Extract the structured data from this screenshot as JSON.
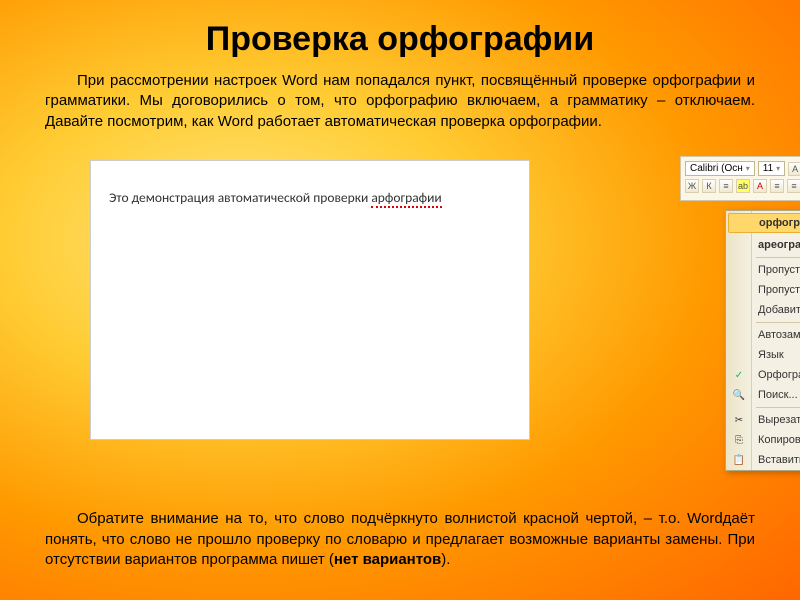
{
  "title": "Проверка орфографии",
  "para1": "При рассмотрении настроек Word нам попадался пункт, посвящённый проверке орфографии и грамматики. Мы договорились о том, что орфографию включаем, а грамматику – отключаем. Давайте посмотрим, как Word работает автоматическая проверка орфографии.",
  "para2_a": "Обратите внимание на то, что слово подчёркнуто волнистой красной чертой, – т.о. Wordдаёт понять, что слово не прошло проверку по словарю и предлагает возможные варианты замены. При отсутствии вариантов программа пишет (",
  "para2_bold": "нет вариантов",
  "para2_b": ").",
  "word": {
    "doc_text_a": "Это демонстрация автоматической проверки ",
    "doc_text_err": "арфографии",
    "toolbar": {
      "font_name": "Calibri (Осн",
      "font_size": "11",
      "btn_bold": "Ж",
      "btn_italic": "К",
      "btn_align": "≡",
      "btn_color_a": "A"
    },
    "menu": {
      "suggest1": "орфографии",
      "suggest2": "ареографии",
      "skip": "Пропустить",
      "skip_all": "Пропустить все",
      "add_dict": "Добавить в словарь",
      "autocorrect": "Автозамена",
      "language": "Язык",
      "spelling": "Орфография...",
      "search": "Поиск...",
      "cut": "Вырезать",
      "copy": "Копировать",
      "paste": "Вставить"
    }
  }
}
